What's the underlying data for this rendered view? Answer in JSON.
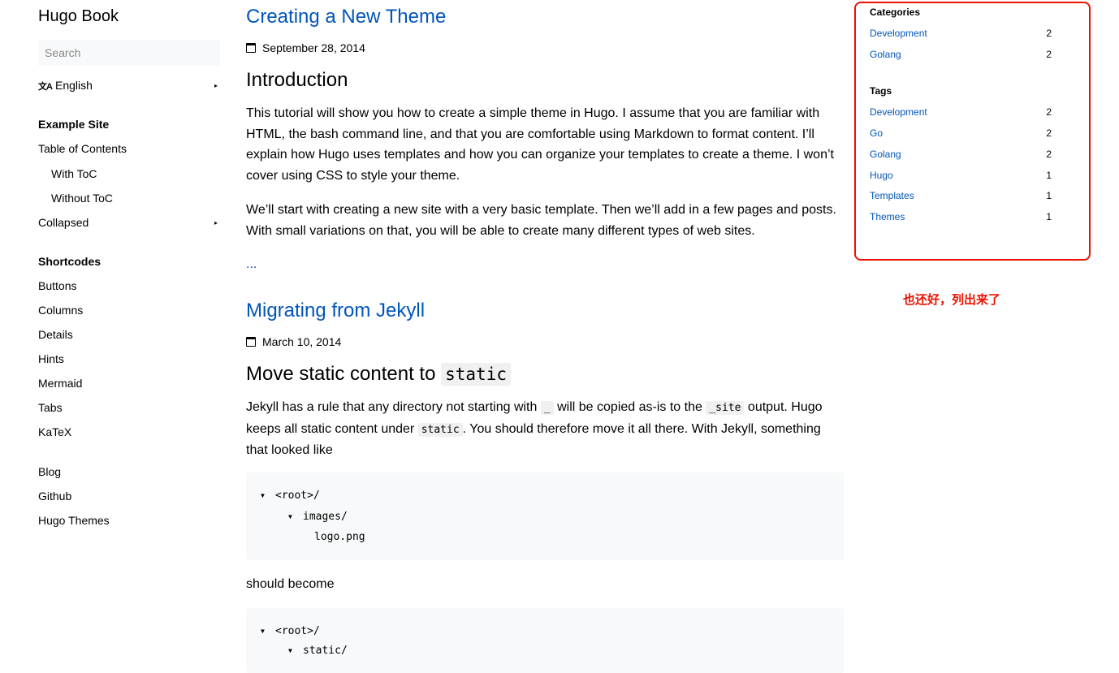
{
  "sidebar": {
    "brand": "Hugo Book",
    "search_placeholder": "Search",
    "language": "English",
    "language_icon": "translate-icon",
    "sections": [
      {
        "title": "Example Site",
        "items": [
          "Table of Contents",
          "With ToC",
          "Without ToC",
          "Collapsed"
        ]
      },
      {
        "title": "Shortcodes",
        "items": [
          "Buttons",
          "Columns",
          "Details",
          "Hints",
          "Mermaid",
          "Tabs",
          "KaTeX"
        ]
      }
    ],
    "links": [
      "Blog",
      "Github",
      "Hugo Themes"
    ]
  },
  "posts": [
    {
      "title": "Creating a New Theme",
      "date": "September 28, 2014",
      "heading": "Introduction",
      "paragraphs": [
        "This tutorial will show you how to create a simple theme in Hugo. I assume that you are familiar with HTML, the bash command line, and that you are comfortable using Markdown to format content. I’ll explain how Hugo uses templates and how you can organize your templates to create a theme. I won’t cover using CSS to style your theme.",
        "We’ll start with creating a new site with a very basic template. Then we’ll add in a few pages and posts. With small variations on that, you will be able to create many different types of web sites."
      ],
      "more": "..."
    },
    {
      "title": "Migrating from Jekyll",
      "date": "March 10, 2014",
      "heading_text": "Move static content to ",
      "heading_code": "static",
      "para_parts": {
        "a": "Jekyll has a rule that any directory not starting with ",
        "code1": "_",
        "b": " will be copied as-is to the ",
        "code2": "_site",
        "c": " output. Hugo keeps all static content under ",
        "code3": "static",
        "d": ". You should therefore move it all there. With Jekyll, something that looked like"
      },
      "code_block_1": [
        "<root>/",
        "images/",
        "logo.png"
      ],
      "between": "should become",
      "code_block_2": [
        "<root>/",
        "static/"
      ]
    }
  ],
  "taxonomies": {
    "categories_title": "Categories",
    "categories": [
      {
        "name": "Development",
        "count": "2"
      },
      {
        "name": "Golang",
        "count": "2"
      }
    ],
    "tags_title": "Tags",
    "tags": [
      {
        "name": "Development",
        "count": "2"
      },
      {
        "name": "Go",
        "count": "2"
      },
      {
        "name": "Golang",
        "count": "2"
      },
      {
        "name": "Hugo",
        "count": "1"
      },
      {
        "name": "Templates",
        "count": "1"
      },
      {
        "name": "Themes",
        "count": "1"
      }
    ]
  },
  "annotation": "也还好，列出来了",
  "colors": {
    "link": "#0055bb",
    "annotation": "#ee1100",
    "code_bg": "#f8f9fa"
  }
}
